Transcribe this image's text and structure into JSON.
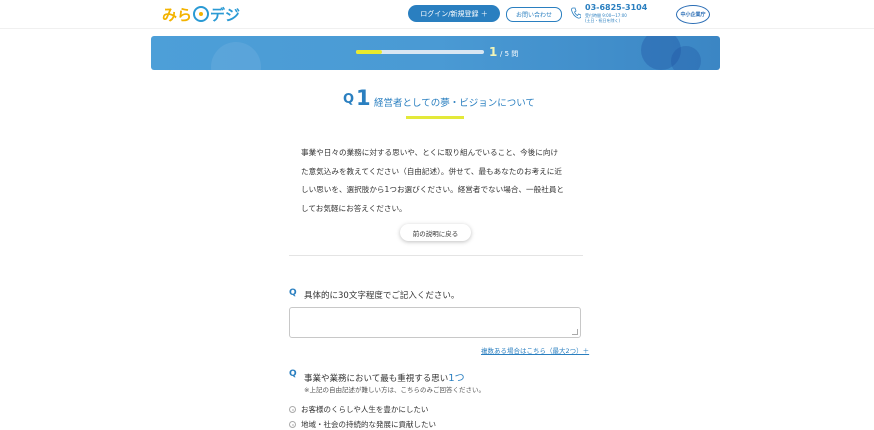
{
  "header": {
    "logo": {
      "part1": "みら",
      "part2": "デジ"
    },
    "login_button": "ログイン/新規登録 ＋",
    "contact_button": "お問い合わせ",
    "phone_number": "03-6825-3104",
    "phone_hours_line1": "受付時間 9:00〜17:00",
    "phone_hours_line2": "(土日・祝日を除く)",
    "partner_logo": "中小企業庁",
    "icons": [
      "phone-icon"
    ]
  },
  "progress": {
    "current": "1",
    "total": "/ 5",
    "suffix": "問",
    "fraction": 0.2,
    "color_fill": "#e9ea2e"
  },
  "question": {
    "mark": "Q",
    "number": "1",
    "title": "経営者としての夢・ビジョンについて",
    "description_lines": [
      "事業や日々の業務に対する思いや、とくに取り組んでいること、今後に向け",
      "た意気込みを教えてください（自由記述）。併せて、最もあなたのお考えに近",
      "しい思いを、選択肢から1つお選びください。経営者でない場合、一般社員と",
      "してお気軽にお答えください。"
    ],
    "back_button": "前の説明に戻る"
  },
  "sub_question_1": {
    "mark": "Q",
    "text": "具体的に30文字程度でご記入ください。",
    "textarea_value": "",
    "more_link": "複数ある場合はこちら（最大2つ）＋"
  },
  "sub_question_2": {
    "mark": "Q",
    "text": "事業や業務において最も重視する思い",
    "highlight": "1つ",
    "note": "※上記の自由記述が難しい方は、こちらのみご回答ください。",
    "options": [
      "お客様のくらしや人生を豊かにしたい",
      "地域・社会の持続的な発展に貢献したい"
    ]
  },
  "colors": {
    "accent": "#2a7fc0",
    "yellow": "#e3e93a",
    "logo_yellow": "#f3b300"
  }
}
